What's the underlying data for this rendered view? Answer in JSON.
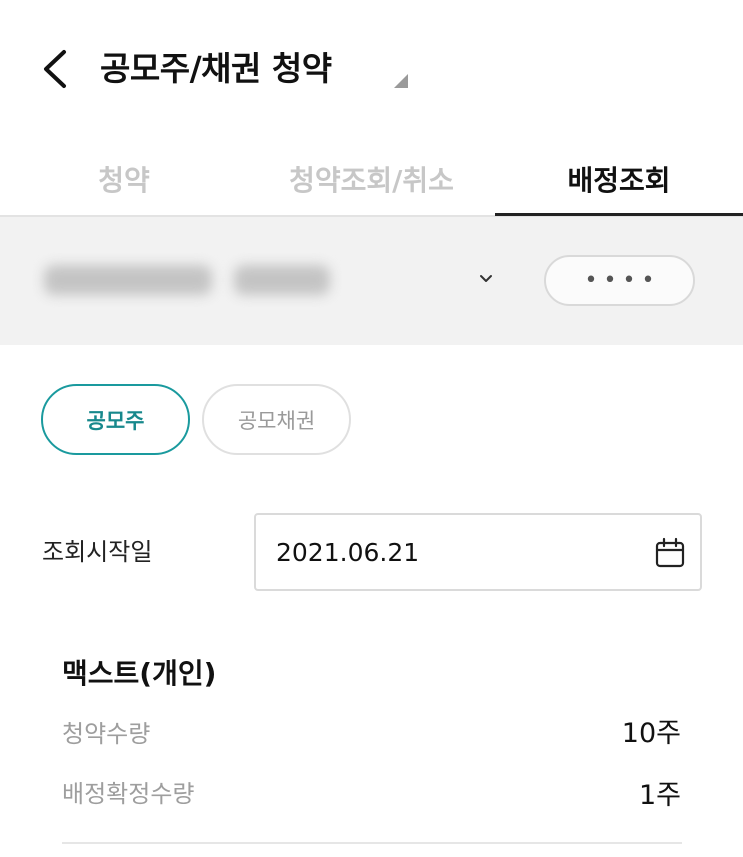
{
  "header": {
    "title": "공모주/채권 청약",
    "back_icon": "chevron-left-icon",
    "caret_icon": "dropdown-caret-icon"
  },
  "tabs": [
    {
      "label": "청약",
      "active": false
    },
    {
      "label": "청약조회/취소",
      "active": false
    },
    {
      "label": "배정조회",
      "active": true
    }
  ],
  "account": {
    "dropdown_icon": "chevron-down-icon",
    "password_mask": "••••"
  },
  "filters": {
    "ipo_label": "공모주",
    "bond_label": "공모채권",
    "selected": "공모주"
  },
  "date_query": {
    "label": "조회시작일",
    "value": "2021.06.21",
    "icon": "calendar-icon"
  },
  "result": {
    "name": "맥스트(개인)",
    "rows": [
      {
        "label": "청약수량",
        "value": "10주"
      },
      {
        "label": "배정확정수량",
        "value": "1주"
      }
    ]
  },
  "colors": {
    "accent": "#1a9a9e",
    "inactive_tab": "#c7c7c7",
    "muted_text": "#9e9e9e",
    "account_bg": "#f2f2f2"
  }
}
